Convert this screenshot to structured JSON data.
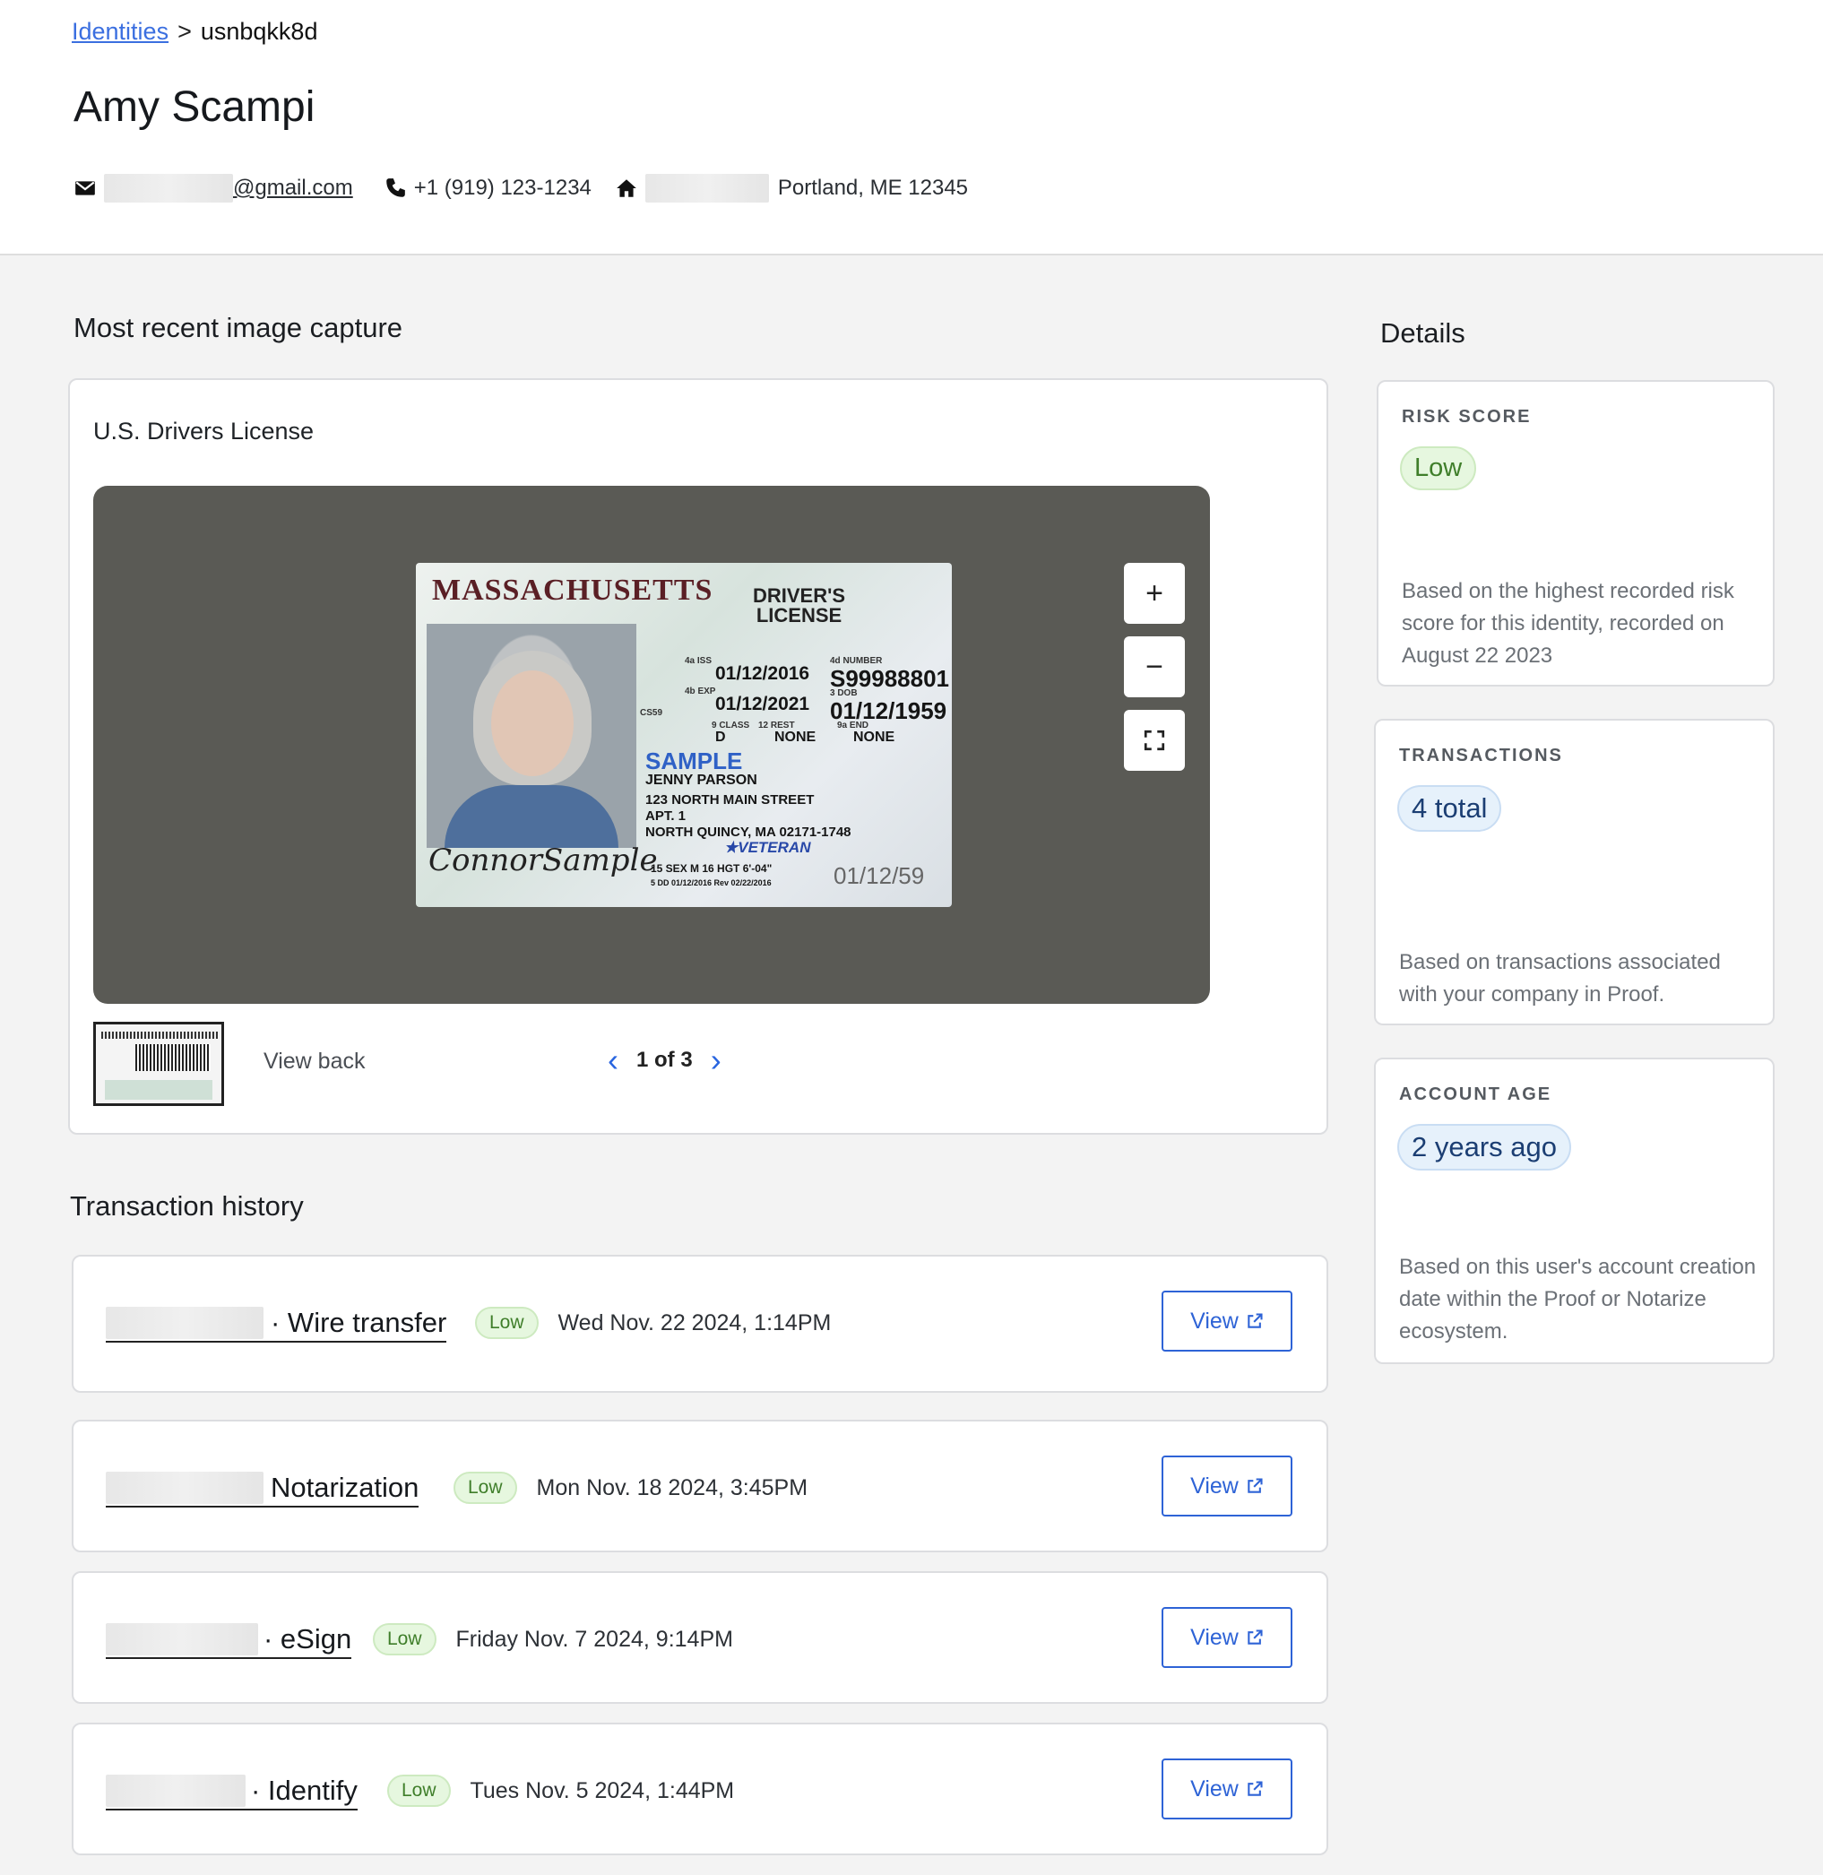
{
  "breadcrumb": {
    "parent": "Identities",
    "separator": ">",
    "current": "usnbqkk8d"
  },
  "identity": {
    "name": "Amy Scampi",
    "email_domain": "@gmail.com",
    "phone": "+1 (919) 123-1234",
    "address_city": "Portland, ME 12345"
  },
  "image_capture": {
    "section_title": "Most recent image capture",
    "card_title": "U.S. Drivers License",
    "zoom_in": "+",
    "zoom_out": "−",
    "fullscreen": "⛶",
    "view_back": "View back",
    "pager": "1 of 3",
    "prev": "‹",
    "next": "›",
    "license": {
      "state": "MASSACHUSETTS",
      "type_line1": "DRIVER'S",
      "type_line2": "LICENSE",
      "iss_label": "4a ISS",
      "iss": "01/12/2016",
      "exp_label": "4b EXP",
      "exp": "01/12/2021",
      "number_label": "4d NUMBER",
      "number": "S99988801",
      "dob_label": "3 DOB",
      "dob": "01/12/1959",
      "class_label": "9 CLASS",
      "class": "D",
      "rest_label": "12 REST",
      "rest": "NONE",
      "end_label": "9a END",
      "end": "NONE",
      "sample": "SAMPLE",
      "holder": "JENNY PARSON",
      "street": "123 NORTH MAIN STREET",
      "apt": "APT. 1",
      "city": "NORTH QUINCY, MA 02171-1748",
      "veteran": "★VETERAN",
      "sex_hgt": "15 SEX M   16 HGT 6'-04\"",
      "dd": "5 DD 01/12/2016 Rev 02/22/2016",
      "dob_small": "01/12/59",
      "signature": "ConnorSample",
      "cs": "CS59"
    }
  },
  "transactions": {
    "section_title": "Transaction history",
    "view_label": "View",
    "items": [
      {
        "type": "· Wire transfer",
        "risk": "Low",
        "date": "Wed Nov. 22 2024, 1:14PM"
      },
      {
        "type": "Notarization",
        "risk": "Low",
        "date": "Mon Nov. 18 2024, 3:45PM"
      },
      {
        "type": "· eSign",
        "risk": "Low",
        "date": "Friday Nov. 7 2024, 9:14PM"
      },
      {
        "type": "· Identify",
        "risk": "Low",
        "date": "Tues Nov. 5 2024, 1:44PM"
      }
    ]
  },
  "details": {
    "title": "Details",
    "risk": {
      "label": "RISK SCORE",
      "value": "Low",
      "desc": "Based on the highest recorded risk score for this identity, recorded on August 22 2023"
    },
    "transactions": {
      "label": "TRANSACTIONS",
      "value": "4 total",
      "desc": "Based on transactions associated with your company in Proof."
    },
    "account_age": {
      "label": "ACCOUNT AGE",
      "value": "2 years ago",
      "desc": "Based on this user's account creation date within the Proof or Notarize ecosystem."
    }
  },
  "colors": {
    "link": "#3b6fe0",
    "low_badge_bg": "#e6f7df",
    "accent": "#2e63d6",
    "viewer_bg": "#5a5a55"
  }
}
